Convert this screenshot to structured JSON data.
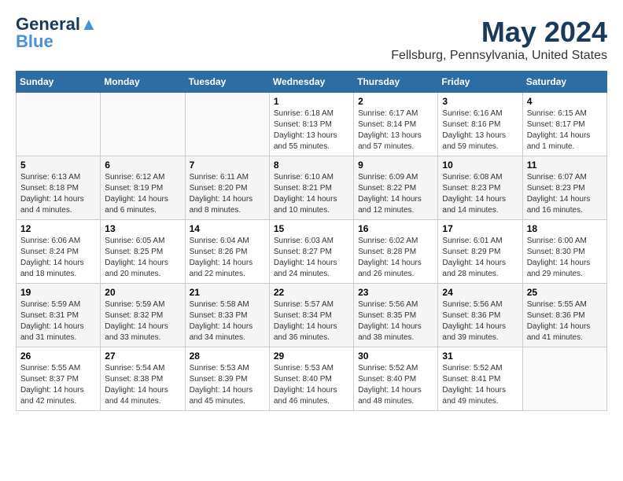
{
  "logo": {
    "general": "General",
    "blue": "Blue"
  },
  "title": "May 2024",
  "location": "Fellsburg, Pennsylvania, United States",
  "days_of_week": [
    "Sunday",
    "Monday",
    "Tuesday",
    "Wednesday",
    "Thursday",
    "Friday",
    "Saturday"
  ],
  "weeks": [
    [
      {
        "day": "",
        "sunrise": "",
        "sunset": "",
        "daylight": ""
      },
      {
        "day": "",
        "sunrise": "",
        "sunset": "",
        "daylight": ""
      },
      {
        "day": "",
        "sunrise": "",
        "sunset": "",
        "daylight": ""
      },
      {
        "day": "1",
        "sunrise": "Sunrise: 6:18 AM",
        "sunset": "Sunset: 8:13 PM",
        "daylight": "Daylight: 13 hours and 55 minutes."
      },
      {
        "day": "2",
        "sunrise": "Sunrise: 6:17 AM",
        "sunset": "Sunset: 8:14 PM",
        "daylight": "Daylight: 13 hours and 57 minutes."
      },
      {
        "day": "3",
        "sunrise": "Sunrise: 6:16 AM",
        "sunset": "Sunset: 8:16 PM",
        "daylight": "Daylight: 13 hours and 59 minutes."
      },
      {
        "day": "4",
        "sunrise": "Sunrise: 6:15 AM",
        "sunset": "Sunset: 8:17 PM",
        "daylight": "Daylight: 14 hours and 1 minute."
      }
    ],
    [
      {
        "day": "5",
        "sunrise": "Sunrise: 6:13 AM",
        "sunset": "Sunset: 8:18 PM",
        "daylight": "Daylight: 14 hours and 4 minutes."
      },
      {
        "day": "6",
        "sunrise": "Sunrise: 6:12 AM",
        "sunset": "Sunset: 8:19 PM",
        "daylight": "Daylight: 14 hours and 6 minutes."
      },
      {
        "day": "7",
        "sunrise": "Sunrise: 6:11 AM",
        "sunset": "Sunset: 8:20 PM",
        "daylight": "Daylight: 14 hours and 8 minutes."
      },
      {
        "day": "8",
        "sunrise": "Sunrise: 6:10 AM",
        "sunset": "Sunset: 8:21 PM",
        "daylight": "Daylight: 14 hours and 10 minutes."
      },
      {
        "day": "9",
        "sunrise": "Sunrise: 6:09 AM",
        "sunset": "Sunset: 8:22 PM",
        "daylight": "Daylight: 14 hours and 12 minutes."
      },
      {
        "day": "10",
        "sunrise": "Sunrise: 6:08 AM",
        "sunset": "Sunset: 8:23 PM",
        "daylight": "Daylight: 14 hours and 14 minutes."
      },
      {
        "day": "11",
        "sunrise": "Sunrise: 6:07 AM",
        "sunset": "Sunset: 8:23 PM",
        "daylight": "Daylight: 14 hours and 16 minutes."
      }
    ],
    [
      {
        "day": "12",
        "sunrise": "Sunrise: 6:06 AM",
        "sunset": "Sunset: 8:24 PM",
        "daylight": "Daylight: 14 hours and 18 minutes."
      },
      {
        "day": "13",
        "sunrise": "Sunrise: 6:05 AM",
        "sunset": "Sunset: 8:25 PM",
        "daylight": "Daylight: 14 hours and 20 minutes."
      },
      {
        "day": "14",
        "sunrise": "Sunrise: 6:04 AM",
        "sunset": "Sunset: 8:26 PM",
        "daylight": "Daylight: 14 hours and 22 minutes."
      },
      {
        "day": "15",
        "sunrise": "Sunrise: 6:03 AM",
        "sunset": "Sunset: 8:27 PM",
        "daylight": "Daylight: 14 hours and 24 minutes."
      },
      {
        "day": "16",
        "sunrise": "Sunrise: 6:02 AM",
        "sunset": "Sunset: 8:28 PM",
        "daylight": "Daylight: 14 hours and 26 minutes."
      },
      {
        "day": "17",
        "sunrise": "Sunrise: 6:01 AM",
        "sunset": "Sunset: 8:29 PM",
        "daylight": "Daylight: 14 hours and 28 minutes."
      },
      {
        "day": "18",
        "sunrise": "Sunrise: 6:00 AM",
        "sunset": "Sunset: 8:30 PM",
        "daylight": "Daylight: 14 hours and 29 minutes."
      }
    ],
    [
      {
        "day": "19",
        "sunrise": "Sunrise: 5:59 AM",
        "sunset": "Sunset: 8:31 PM",
        "daylight": "Daylight: 14 hours and 31 minutes."
      },
      {
        "day": "20",
        "sunrise": "Sunrise: 5:59 AM",
        "sunset": "Sunset: 8:32 PM",
        "daylight": "Daylight: 14 hours and 33 minutes."
      },
      {
        "day": "21",
        "sunrise": "Sunrise: 5:58 AM",
        "sunset": "Sunset: 8:33 PM",
        "daylight": "Daylight: 14 hours and 34 minutes."
      },
      {
        "day": "22",
        "sunrise": "Sunrise: 5:57 AM",
        "sunset": "Sunset: 8:34 PM",
        "daylight": "Daylight: 14 hours and 36 minutes."
      },
      {
        "day": "23",
        "sunrise": "Sunrise: 5:56 AM",
        "sunset": "Sunset: 8:35 PM",
        "daylight": "Daylight: 14 hours and 38 minutes."
      },
      {
        "day": "24",
        "sunrise": "Sunrise: 5:56 AM",
        "sunset": "Sunset: 8:36 PM",
        "daylight": "Daylight: 14 hours and 39 minutes."
      },
      {
        "day": "25",
        "sunrise": "Sunrise: 5:55 AM",
        "sunset": "Sunset: 8:36 PM",
        "daylight": "Daylight: 14 hours and 41 minutes."
      }
    ],
    [
      {
        "day": "26",
        "sunrise": "Sunrise: 5:55 AM",
        "sunset": "Sunset: 8:37 PM",
        "daylight": "Daylight: 14 hours and 42 minutes."
      },
      {
        "day": "27",
        "sunrise": "Sunrise: 5:54 AM",
        "sunset": "Sunset: 8:38 PM",
        "daylight": "Daylight: 14 hours and 44 minutes."
      },
      {
        "day": "28",
        "sunrise": "Sunrise: 5:53 AM",
        "sunset": "Sunset: 8:39 PM",
        "daylight": "Daylight: 14 hours and 45 minutes."
      },
      {
        "day": "29",
        "sunrise": "Sunrise: 5:53 AM",
        "sunset": "Sunset: 8:40 PM",
        "daylight": "Daylight: 14 hours and 46 minutes."
      },
      {
        "day": "30",
        "sunrise": "Sunrise: 5:52 AM",
        "sunset": "Sunset: 8:40 PM",
        "daylight": "Daylight: 14 hours and 48 minutes."
      },
      {
        "day": "31",
        "sunrise": "Sunrise: 5:52 AM",
        "sunset": "Sunset: 8:41 PM",
        "daylight": "Daylight: 14 hours and 49 minutes."
      },
      {
        "day": "",
        "sunrise": "",
        "sunset": "",
        "daylight": ""
      }
    ]
  ]
}
